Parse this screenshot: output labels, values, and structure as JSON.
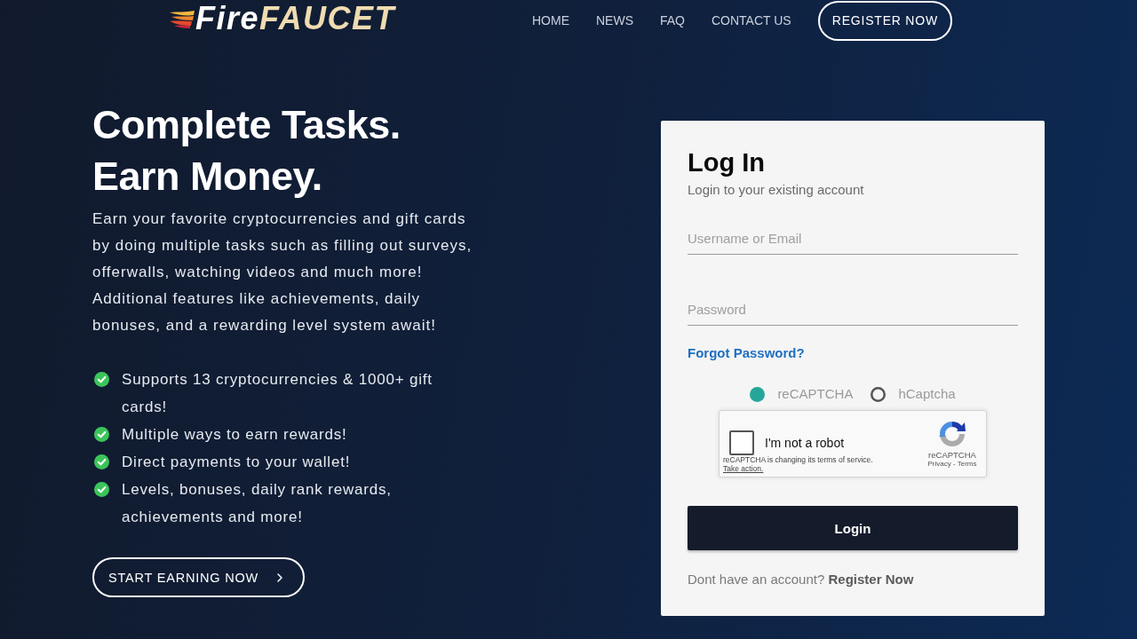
{
  "header": {
    "logo": {
      "part_1": "Fire",
      "part_2": "FAUCET"
    },
    "nav": [
      {
        "label": "HOME"
      },
      {
        "label": "NEWS"
      },
      {
        "label": "FAQ"
      },
      {
        "label": "CONTACT US"
      }
    ],
    "register_button": "REGISTER NOW"
  },
  "hero": {
    "headline": [
      "Complete Tasks.",
      "Earn Money."
    ],
    "description": "Earn your favorite cryptocurrencies and gift cards by doing multiple tasks such as filling out surveys, offerwalls, watching videos and much more! Additional features like achievements, daily bonuses, and a rewarding level system await!",
    "features": [
      "Supports 13 cryptocurrencies & 1000+ gift cards!",
      "Multiple ways to earn rewards!",
      "Direct payments to your wallet!",
      "Levels, bonuses, daily rank rewards, achievements and more!"
    ],
    "cta_button": "START EARNING NOW"
  },
  "login": {
    "title": "Log In",
    "subtitle": "Login to your existing account",
    "fields": [
      {
        "placeholder": "Username or Email"
      },
      {
        "placeholder": "Password"
      }
    ],
    "forgot_link": "Forgot Password?",
    "captcha_options": [
      {
        "label": "reCAPTCHA",
        "selected": true
      },
      {
        "label": "hCaptcha",
        "selected": false
      }
    ],
    "recaptcha": {
      "checked": false,
      "label": "I'm not a robot",
      "notice": "reCAPTCHA is changing its terms of service.",
      "action_link": "Take action.",
      "brand": "reCAPTCHA",
      "links": "Privacy - Terms"
    },
    "submit_button": "Login",
    "signup_prompt": "Dont have an account?",
    "signup_link": "Register Now"
  }
}
